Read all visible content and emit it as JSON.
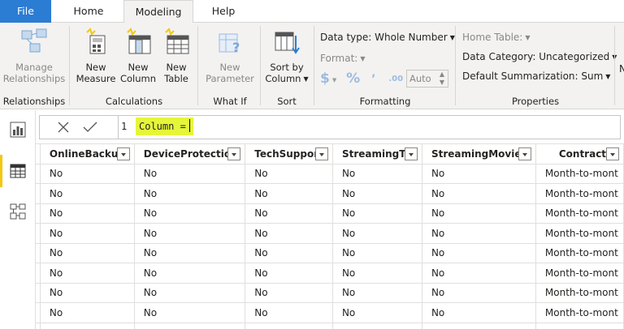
{
  "tabs": {
    "file": "File",
    "home": "Home",
    "modeling": "Modeling",
    "help": "Help"
  },
  "ribbon": {
    "relationships": {
      "manage_line1": "Manage",
      "manage_line2": "Relationships",
      "group": "Relationships"
    },
    "calculations": {
      "new_measure_line1": "New",
      "new_measure_line2": "Measure",
      "new_column_line1": "New",
      "new_column_line2": "Column",
      "new_table_line1": "New",
      "new_table_line2": "Table",
      "group": "Calculations"
    },
    "what_if": {
      "new_parameter_line1": "New",
      "new_parameter_line2": "Parameter",
      "group": "What If"
    },
    "sort": {
      "sort_by_line1": "Sort by",
      "sort_by_line2": "Column",
      "group": "Sort"
    },
    "formatting": {
      "data_type": "Data type: Whole Number",
      "format": "Format:",
      "currency_symbol": "$",
      "percent_symbol": "%",
      "comma_symbol": "’",
      "decimal_symbol": ".00",
      "auto": "Auto",
      "group": "Formatting"
    },
    "properties": {
      "home_table": "Home Table:",
      "data_category": "Data Category: Uncategorized",
      "default_summarization": "Default Summarization: Sum",
      "group": "Properties"
    },
    "overflow_letter": "N"
  },
  "formula": {
    "line_number": "1",
    "code": "Column ="
  },
  "table": {
    "columns": [
      "OnlineBackup",
      "DeviceProtection",
      "TechSupport",
      "StreamingTV",
      "StreamingMovies",
      "Contract"
    ],
    "rows": [
      [
        "No",
        "No",
        "No",
        "No",
        "No",
        "Month-to-mont"
      ],
      [
        "No",
        "No",
        "No",
        "No",
        "No",
        "Month-to-mont"
      ],
      [
        "No",
        "No",
        "No",
        "No",
        "No",
        "Month-to-mont"
      ],
      [
        "No",
        "No",
        "No",
        "No",
        "No",
        "Month-to-mont"
      ],
      [
        "No",
        "No",
        "No",
        "No",
        "No",
        "Month-to-mont"
      ],
      [
        "No",
        "No",
        "No",
        "No",
        "No",
        "Month-to-mont"
      ],
      [
        "No",
        "No",
        "No",
        "No",
        "No",
        "Month-to-mont"
      ],
      [
        "No",
        "No",
        "No",
        "No",
        "No",
        "Month-to-mont"
      ],
      [
        "",
        "",
        "",
        "",
        "",
        ""
      ]
    ]
  },
  "colors": {
    "file_tab": "#2b7cd3",
    "active_rail": "#f2c811",
    "formula_highlight": "#e5f53a"
  }
}
